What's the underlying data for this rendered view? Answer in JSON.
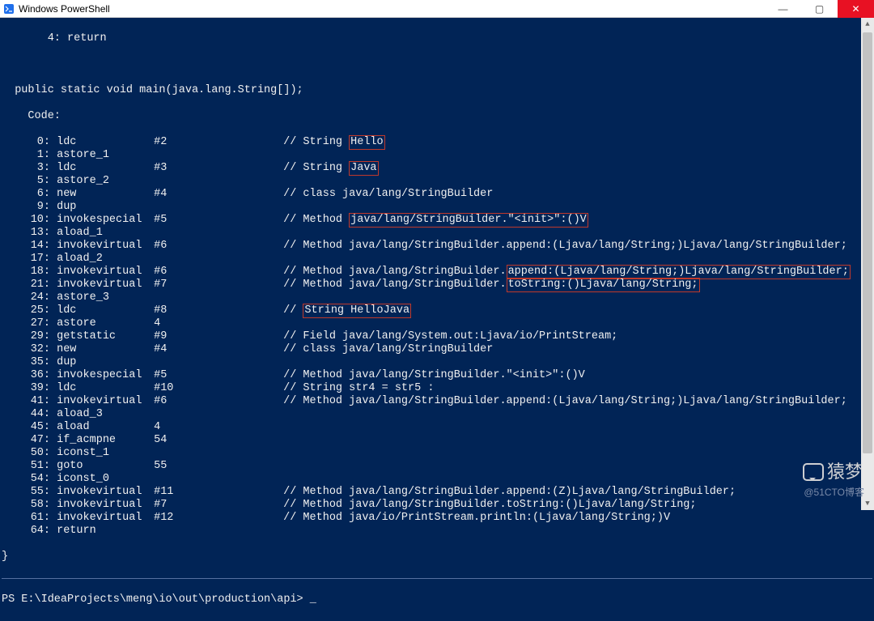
{
  "window": {
    "title": "Windows PowerShell"
  },
  "code": {
    "pre1": "       4: return",
    "pre2": "",
    "sig": "  public static void main(java.lang.String[]);",
    "codeLabel": "    Code:",
    "lines": [
      {
        "off": "0:",
        "op": "ldc",
        "arg": "#2",
        "cmt_pre": "// String ",
        "box": "Hello",
        "cmt_post": ""
      },
      {
        "off": "1:",
        "op": "astore_1",
        "arg": "",
        "cmt": ""
      },
      {
        "off": "3:",
        "op": "ldc",
        "arg": "#3",
        "cmt_pre": "// String ",
        "box": "Java",
        "cmt_post": ""
      },
      {
        "off": "5:",
        "op": "astore_2",
        "arg": "",
        "cmt": ""
      },
      {
        "off": "6:",
        "op": "new",
        "arg": "#4",
        "cmt": "// class java/lang/StringBuilder"
      },
      {
        "off": "9:",
        "op": "dup",
        "arg": "",
        "cmt": ""
      },
      {
        "off": "10:",
        "op": "invokespecial",
        "arg": "#5",
        "cmt_pre": "// Method ",
        "box": "java/lang/StringBuilder.\"<init>\":()V",
        "cmt_post": ""
      },
      {
        "off": "13:",
        "op": "aload_1",
        "arg": "",
        "cmt": ""
      },
      {
        "off": "14:",
        "op": "invokevirtual",
        "arg": "#6",
        "cmt": "// Method java/lang/StringBuilder.append:(Ljava/lang/String;)Ljava/lang/StringBuilder;"
      },
      {
        "off": "17:",
        "op": "aload_2",
        "arg": "",
        "cmt": ""
      },
      {
        "off": "18:",
        "op": "invokevirtual",
        "arg": "#6",
        "cmt_pre": "// Method java/lang/StringBuilder.",
        "box": "append:(Ljava/lang/String;)Ljava/lang/StringBuilder;",
        "cmt_post": ""
      },
      {
        "off": "21:",
        "op": "invokevirtual",
        "arg": "#7",
        "cmt_pre": "// Method java/lang/StringBuilder.",
        "box": "toString:()Ljava/lang/String;",
        "cmt_post": ""
      },
      {
        "off": "24:",
        "op": "astore_3",
        "arg": "",
        "cmt": ""
      },
      {
        "off": "25:",
        "op": "ldc",
        "arg": "#8",
        "cmt_pre": "// ",
        "box": "String HelloJava",
        "cmt_post": ""
      },
      {
        "off": "27:",
        "op": "astore",
        "arg": "4",
        "cmt": ""
      },
      {
        "off": "29:",
        "op": "getstatic",
        "arg": "#9",
        "cmt": "// Field java/lang/System.out:Ljava/io/PrintStream;"
      },
      {
        "off": "32:",
        "op": "new",
        "arg": "#4",
        "cmt": "// class java/lang/StringBuilder"
      },
      {
        "off": "35:",
        "op": "dup",
        "arg": "",
        "cmt": ""
      },
      {
        "off": "36:",
        "op": "invokespecial",
        "arg": "#5",
        "cmt": "// Method java/lang/StringBuilder.\"<init>\":()V"
      },
      {
        "off": "39:",
        "op": "ldc",
        "arg": "#10",
        "cmt": "// String str4 = str5 :"
      },
      {
        "off": "41:",
        "op": "invokevirtual",
        "arg": "#6",
        "cmt": "// Method java/lang/StringBuilder.append:(Ljava/lang/String;)Ljava/lang/StringBuilder;"
      },
      {
        "off": "44:",
        "op": "aload_3",
        "arg": "",
        "cmt": ""
      },
      {
        "off": "45:",
        "op": "aload",
        "arg": "4",
        "cmt": ""
      },
      {
        "off": "47:",
        "op": "if_acmpne",
        "arg": "54",
        "cmt": ""
      },
      {
        "off": "50:",
        "op": "iconst_1",
        "arg": "",
        "cmt": ""
      },
      {
        "off": "51:",
        "op": "goto",
        "arg": "55",
        "cmt": ""
      },
      {
        "off": "54:",
        "op": "iconst_0",
        "arg": "",
        "cmt": ""
      },
      {
        "off": "55:",
        "op": "invokevirtual",
        "arg": "#11",
        "cmt": "// Method java/lang/StringBuilder.append:(Z)Ljava/lang/StringBuilder;"
      },
      {
        "off": "58:",
        "op": "invokevirtual",
        "arg": "#7",
        "cmt": "// Method java/lang/StringBuilder.toString:()Ljava/lang/String;"
      },
      {
        "off": "61:",
        "op": "invokevirtual",
        "arg": "#12",
        "cmt": "// Method java/io/PrintStream.println:(Ljava/lang/String;)V"
      },
      {
        "off": "64:",
        "op": "return",
        "arg": "",
        "cmt": ""
      }
    ],
    "closeBrace": "}"
  },
  "prompt": "PS E:\\IdeaProjects\\meng\\io\\out\\production\\api>",
  "watermark": {
    "brand": "猿梦",
    "credit": "@51CTO博客"
  }
}
